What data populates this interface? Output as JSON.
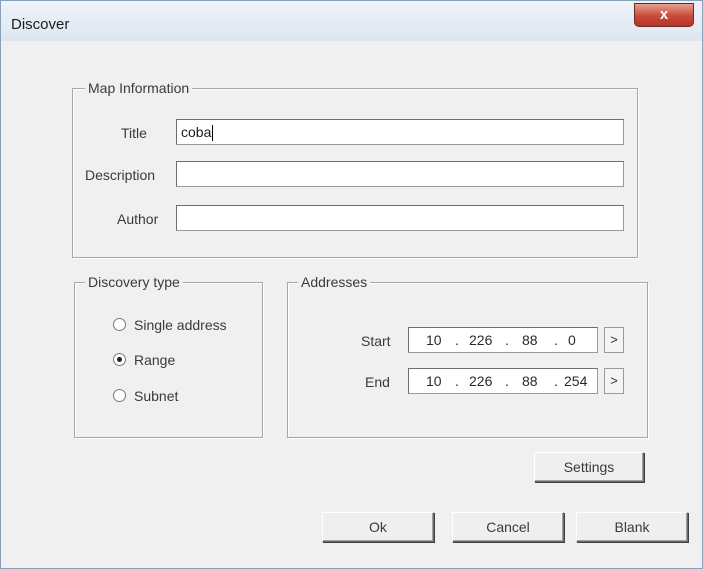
{
  "window": {
    "title": "Discover",
    "close_glyph": "x"
  },
  "map_information": {
    "legend": "Map Information",
    "title_label": "Title",
    "title_value": "coba",
    "description_label": "Description",
    "description_value": "",
    "author_label": "Author",
    "author_value": ""
  },
  "discovery_type": {
    "legend": "Discovery type",
    "options": [
      {
        "label": "Single address",
        "selected": false
      },
      {
        "label": "Range",
        "selected": true
      },
      {
        "label": "Subnet",
        "selected": false
      }
    ]
  },
  "addresses": {
    "legend": "Addresses",
    "start_label": "Start",
    "start_octets": [
      "10",
      "226",
      "88",
      "0"
    ],
    "end_label": "End",
    "end_octets": [
      "10",
      "226",
      "88",
      "254"
    ],
    "dot": ".",
    "arrow_glyph": ">"
  },
  "buttons": {
    "settings": "Settings",
    "ok": "Ok",
    "cancel": "Cancel",
    "blank": "Blank"
  }
}
